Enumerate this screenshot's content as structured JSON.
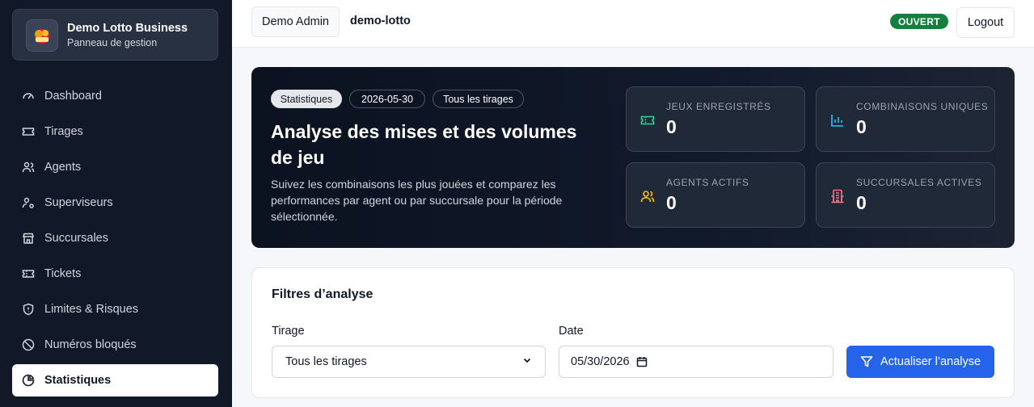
{
  "brand": {
    "title": "Demo Lotto Business",
    "subtitle": "Panneau de gestion"
  },
  "sidebar": {
    "items": [
      {
        "label": "Dashboard",
        "icon": "gauge-icon"
      },
      {
        "label": "Tirages",
        "icon": "ticket-icon"
      },
      {
        "label": "Agents",
        "icon": "users-icon"
      },
      {
        "label": "Superviseurs",
        "icon": "user-cog-icon"
      },
      {
        "label": "Succursales",
        "icon": "store-icon"
      },
      {
        "label": "Tickets",
        "icon": "ticket-icon"
      },
      {
        "label": "Limites & Risques",
        "icon": "shield-icon"
      },
      {
        "label": "Numéros bloqués",
        "icon": "ban-icon"
      },
      {
        "label": "Statistiques",
        "icon": "pie-chart-icon",
        "active": true
      }
    ]
  },
  "topbar": {
    "admin_label": "Demo Admin",
    "org": "demo-lotto",
    "status": "OUVERT",
    "logout_label": "Logout",
    "status_color": "#15803d"
  },
  "hero": {
    "pills": [
      "Statistiques",
      "2026-05-30",
      "Tous les tirages"
    ],
    "title": "Analyse des mises et des volumes de jeu",
    "description": "Suivez les combinaisons les plus jouées et comparez les performances par agent ou par succursale pour la période sélectionnée.",
    "stats": [
      {
        "label": "JEUX ENREGISTRÉS",
        "value": "0",
        "icon": "ticket-icon",
        "color": "#34d399"
      },
      {
        "label": "COMBINAISONS UNIQUES",
        "value": "0",
        "icon": "bar-chart-icon",
        "color": "#38bdf8"
      },
      {
        "label": "AGENTS ACTIFS",
        "value": "0",
        "icon": "users-icon",
        "color": "#fbbf24"
      },
      {
        "label": "SUCCURSALES ACTIVES",
        "value": "0",
        "icon": "building-icon",
        "color": "#fb7185"
      }
    ]
  },
  "filters": {
    "title": "Filtres d’analyse",
    "tirage_label": "Tirage",
    "tirage_value": "Tous les tirages",
    "date_label": "Date",
    "date_value": "05/30/2026",
    "submit_label": "Actualiser l’analyse"
  },
  "colors": {
    "accent": "#2563eb",
    "sidebar_bg": "#111827"
  }
}
